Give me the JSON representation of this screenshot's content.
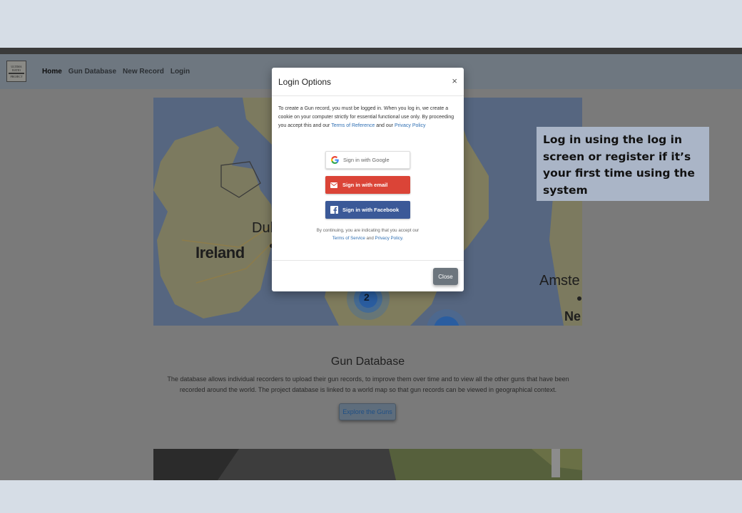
{
  "nav": {
    "logo_lines": [
      "ULTIMA",
      "RATIO",
      "PROJECT"
    ],
    "links": [
      "Home",
      "Gun Database",
      "New Record",
      "Login"
    ]
  },
  "map": {
    "labels": {
      "ireland": "Ireland",
      "dublin": "Dul",
      "amsterdam": "Amste",
      "ne": "Ne"
    },
    "cluster_count": "2"
  },
  "section": {
    "title": "Gun Database",
    "body": "The database allows individual recorders to upload their gun records, to improve them over time and to view all the other guns that have been recorded around the world. The project database is linked to a world map so that gun records can be viewed in geographical context.",
    "button": "Explore the Guns"
  },
  "modal": {
    "title": "Login Options",
    "close_x": "×",
    "text_before": "To create a Gun record, you must be logged in. When you log in, we create a cookie on your computer strictly for essential functional use only. By proceeding you accept this and our ",
    "terms_ref": "Terms of Reference",
    "and": " and our ",
    "privacy": "Privacy Policy",
    "google": "Sign in with Google",
    "email": "Sign in with email",
    "facebook": "Sign in with Facebook",
    "disclaimer_before": "By continuing, you are indicating that you accept our",
    "tos": "Terms of Service",
    "disclaimer_and": " and ",
    "privacy2": "Privacy Policy.",
    "close_button": "Close"
  },
  "callout": {
    "text": "Log in using the log in screen or register if it’s your first time using the system"
  },
  "colors": {
    "google_red": "#db4437",
    "facebook_blue": "#3b5998",
    "link_blue": "#2f6fb3",
    "callout_bg": "#aab5c7"
  }
}
